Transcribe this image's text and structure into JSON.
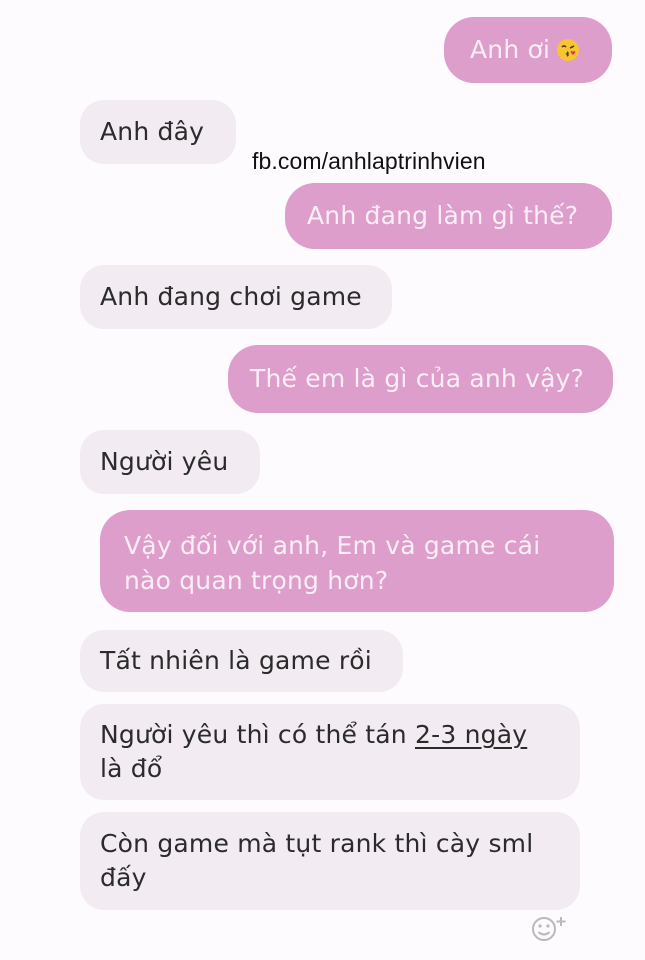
{
  "watermark": "fb.com/anhlaptrinhvien",
  "messages": [
    {
      "side": "out",
      "text": "Anh ơi",
      "emoji": "kissing-face-emoji"
    },
    {
      "side": "in",
      "text": "Anh đây"
    },
    {
      "side": "out",
      "text": "Anh đang làm gì thế?"
    },
    {
      "side": "in",
      "text": "Anh đang chơi game"
    },
    {
      "side": "out",
      "text": "Thế em là gì của anh vậy?"
    },
    {
      "side": "in",
      "text": "Người yêu"
    },
    {
      "side": "out",
      "line1": "Vậy đối với anh, Em và game cái",
      "line2": "nào quan trọng hơn?"
    },
    {
      "side": "in",
      "text": "Tất nhiên là game rồi"
    },
    {
      "side": "in",
      "line1_prefix": "Người yêu thì có thể tán ",
      "line1_underlined": "2-3 ngày",
      "line2": "là đổ"
    },
    {
      "side": "in",
      "line1": "Còn game mà tụt rank thì cày sml",
      "line2": "đấy"
    }
  ],
  "icons": {
    "reaction": "smiley-plus-icon"
  },
  "colors": {
    "outgoing_bubble": "#dd9ecb",
    "incoming_bubble": "#f2ebf2",
    "background": "#fdfbfe"
  }
}
